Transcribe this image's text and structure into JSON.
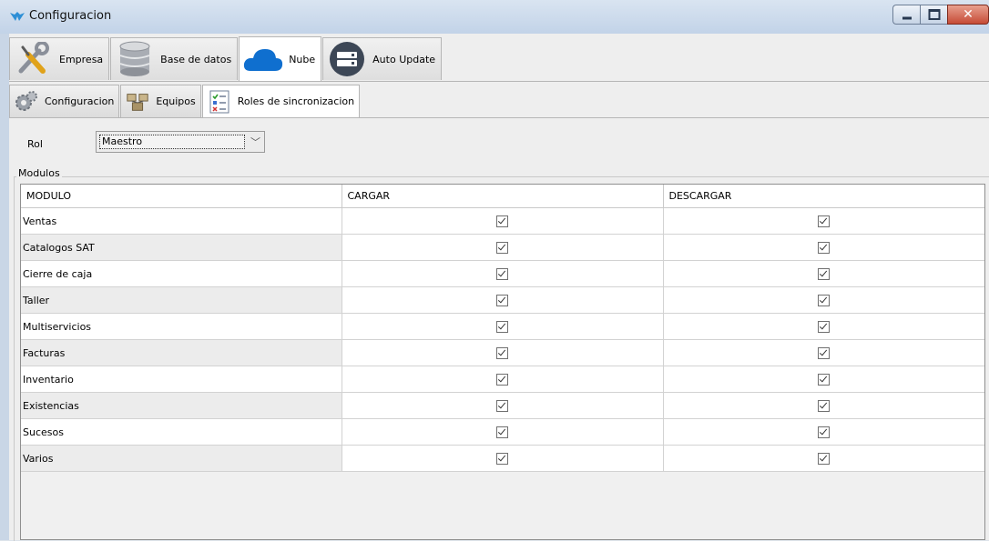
{
  "window": {
    "title": "Configuracion"
  },
  "tabs_main": [
    {
      "label": "Empresa",
      "icon": "tools-icon",
      "active": false
    },
    {
      "label": "Base de datos",
      "icon": "database-icon",
      "active": false
    },
    {
      "label": "Nube",
      "icon": "cloud-icon",
      "active": true
    },
    {
      "label": "Auto Update",
      "icon": "server-icon",
      "active": false
    }
  ],
  "tabs_sub": [
    {
      "label": "Configuracion",
      "icon": "gears-icon",
      "active": false
    },
    {
      "label": "Equipos",
      "icon": "network-icon",
      "active": false
    },
    {
      "label": "Roles de sincronizacion",
      "icon": "checklist-icon",
      "active": true
    }
  ],
  "form": {
    "rol_label": "Rol",
    "rol_value": "Maestro"
  },
  "group": {
    "title": "Modulos"
  },
  "table": {
    "columns": [
      "MODULO",
      "CARGAR",
      "DESCARGAR"
    ],
    "rows": [
      {
        "modulo": "Ventas",
        "cargar": true,
        "descargar": true
      },
      {
        "modulo": "Catalogos SAT",
        "cargar": true,
        "descargar": true
      },
      {
        "modulo": "Cierre de caja",
        "cargar": true,
        "descargar": true
      },
      {
        "modulo": "Taller",
        "cargar": true,
        "descargar": true
      },
      {
        "modulo": "Multiservicios",
        "cargar": true,
        "descargar": true
      },
      {
        "modulo": "Facturas",
        "cargar": true,
        "descargar": true
      },
      {
        "modulo": "Inventario",
        "cargar": true,
        "descargar": true
      },
      {
        "modulo": "Existencias",
        "cargar": true,
        "descargar": true
      },
      {
        "modulo": "Sucesos",
        "cargar": true,
        "descargar": true
      },
      {
        "modulo": "Varios",
        "cargar": true,
        "descargar": true
      }
    ]
  },
  "colors": {
    "accent": "#0f6fcf",
    "titlebar": "#c2d3e8"
  }
}
